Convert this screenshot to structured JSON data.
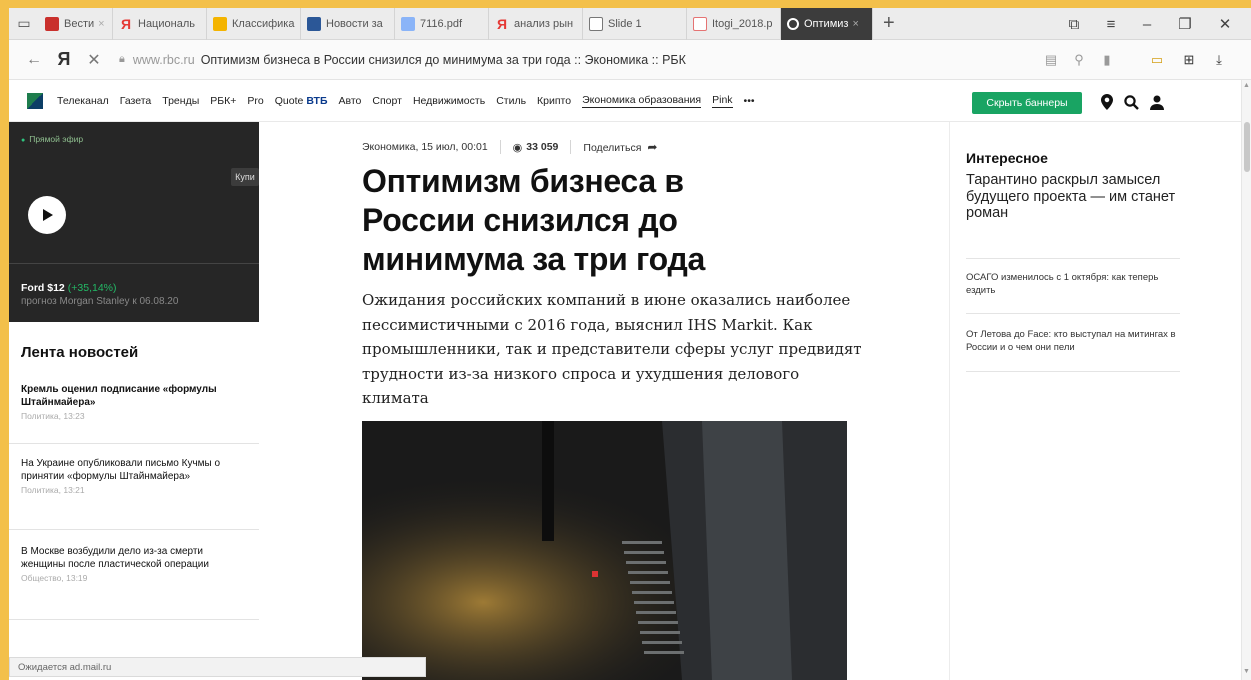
{
  "browser": {
    "tabs": [
      {
        "label": "Вести",
        "fav_color": "#c9302c",
        "fav_text": "",
        "close": "×"
      },
      {
        "label": "Националь",
        "fav_color": "#e53935",
        "fav_text": "Я",
        "close": ""
      },
      {
        "label": "Классифика",
        "fav_color": "#f4b400",
        "fav_text": "",
        "close": ""
      },
      {
        "label": "Новости за",
        "fav_color": "#2b5797",
        "fav_text": "",
        "close": ""
      },
      {
        "label": "7116.pdf",
        "fav_color": "#8ab4f8",
        "fav_text": "",
        "close": ""
      },
      {
        "label": "анализ рын",
        "fav_color": "#e53935",
        "fav_text": "Я",
        "close": ""
      },
      {
        "label": "Slide 1",
        "fav_color": "#ffffff",
        "fav_text": "",
        "close": ""
      },
      {
        "label": "Itogi_2018.p",
        "fav_color": "#e57373",
        "fav_text": "",
        "close": ""
      },
      {
        "label": "Оптимиз",
        "fav_color": "",
        "fav_text": "",
        "close": "×"
      }
    ],
    "new_tab": "+",
    "url_domain": "www.rbc.ru",
    "url_title": "Оптимизм бизнеса в России снизился до минимума за три года :: Экономика :: РБК",
    "ya": "Я",
    "status": "Ожидается ad.mail.ru"
  },
  "rbc_nav": {
    "links": [
      "Телеканал",
      "Газета",
      "Тренды",
      "РБК+",
      "Pro",
      "Quote"
    ],
    "vtb": "ВТБ",
    "links2": [
      "Авто",
      "Спорт",
      "Недвижимость",
      "Стиль",
      "Крипто"
    ],
    "special": "Экономика образования",
    "pink": "Pink",
    "more": "•••",
    "hide_banners": "Скрыть баннеры"
  },
  "live": {
    "label": "Прямой эфир",
    "ticker": "Ford $12",
    "ticker_change": "(+35,14%)",
    "ticker_sub": "прогноз Morgan Stanley к 06.08.20",
    "buy": "Купи"
  },
  "feed": {
    "title": "Лента новостей",
    "items": [
      {
        "title": "Кремль оценил подписание «формулы Штайнмайера»",
        "meta": "Политика, 13:23"
      },
      {
        "title": "На Украине опубликовали письмо Кучмы о принятии «формулы Штайнмайера»",
        "meta": "Политика, 13:21"
      },
      {
        "title": "В Москве возбудили дело из-за смерти женщины после пластической операции",
        "meta": "Общество, 13:19"
      }
    ]
  },
  "article": {
    "category_date": "Экономика, 15 июл, 00:01",
    "views": "33 059",
    "share": "Поделиться",
    "headline": "Оптимизм бизнеса в России снизился до минимума за три года",
    "lead": "Ожидания российских компаний в июне оказались наиболее пессимистичными с 2016 года, выяснил IHS Markit. Как промышленники, так и представители сферы услуг предвидят трудности из-за низкого спроса и ухудшения делового климата"
  },
  "interesting": {
    "title": "Интересное",
    "main": "Тарантино раскрыл замысел будущего проекта — им станет роман",
    "items": [
      "ОСАГО изменилось с 1 октября: как теперь ездить",
      "От Летова до Face: кто выступал на митингах в России и о чем они пели"
    ]
  },
  "colors": {
    "accent_green": "#19a463",
    "frame": "#f3c04a",
    "dark_panel": "#262626"
  },
  "icons": [
    "hub-icon",
    "back-icon",
    "close-icon",
    "lock-icon",
    "reader-icon",
    "search-icon",
    "bookmark-icon",
    "battery-icon",
    "translate-icon",
    "download-icon",
    "location-icon",
    "user-icon",
    "play-icon",
    "eye-icon",
    "share-icon"
  ]
}
